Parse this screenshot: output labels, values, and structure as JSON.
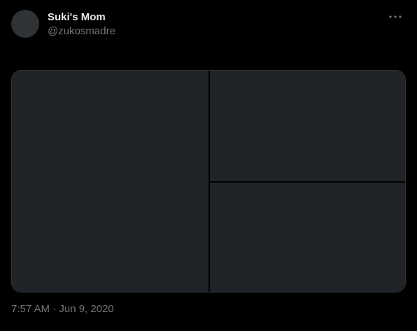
{
  "author": {
    "display_name": "Suki's Mom",
    "handle": "@zukosmadre"
  },
  "icons": {
    "more": "more-horizontal-icon",
    "avatar": "avatar-placeholder"
  },
  "timestamp": "7:57 AM · Jun 9, 2020",
  "colors": {
    "background": "#000000",
    "primary_text": "#e7e9ea",
    "secondary_text": "#71767b",
    "placeholder": "#202327"
  }
}
